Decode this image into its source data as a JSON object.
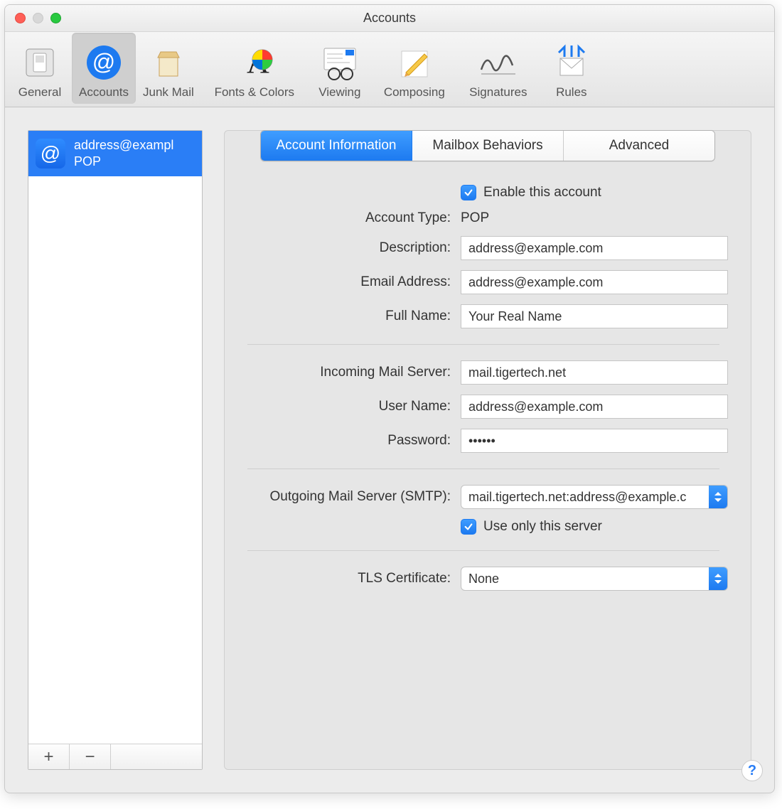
{
  "window": {
    "title": "Accounts"
  },
  "toolbar": {
    "items": [
      {
        "label": "General"
      },
      {
        "label": "Accounts"
      },
      {
        "label": "Junk Mail"
      },
      {
        "label": "Fonts & Colors"
      },
      {
        "label": "Viewing"
      },
      {
        "label": "Composing"
      },
      {
        "label": "Signatures"
      },
      {
        "label": "Rules"
      }
    ],
    "active_index": 1
  },
  "sidebar": {
    "accounts": [
      {
        "label": "address@exampl",
        "type": "POP"
      }
    ],
    "add": "+",
    "remove": "−"
  },
  "tabs": {
    "items": [
      "Account Information",
      "Mailbox Behaviors",
      "Advanced"
    ],
    "active_index": 0
  },
  "form": {
    "enable_label": "Enable this account",
    "enable_checked": true,
    "account_type_label": "Account Type:",
    "account_type_value": "POP",
    "description_label": "Description:",
    "description_value": "address@example.com",
    "email_label": "Email Address:",
    "email_value": "address@example.com",
    "fullname_label": "Full Name:",
    "fullname_value": "Your Real Name",
    "incoming_label": "Incoming Mail Server:",
    "incoming_value": "mail.tigertech.net",
    "username_label": "User Name:",
    "username_value": "address@example.com",
    "password_label": "Password:",
    "password_value": "••••••",
    "smtp_label": "Outgoing Mail Server (SMTP):",
    "smtp_value": "mail.tigertech.net:address@example.c",
    "use_only_label": "Use only this server",
    "use_only_checked": true,
    "tls_label": "TLS Certificate:",
    "tls_value": "None"
  },
  "help_label": "?"
}
